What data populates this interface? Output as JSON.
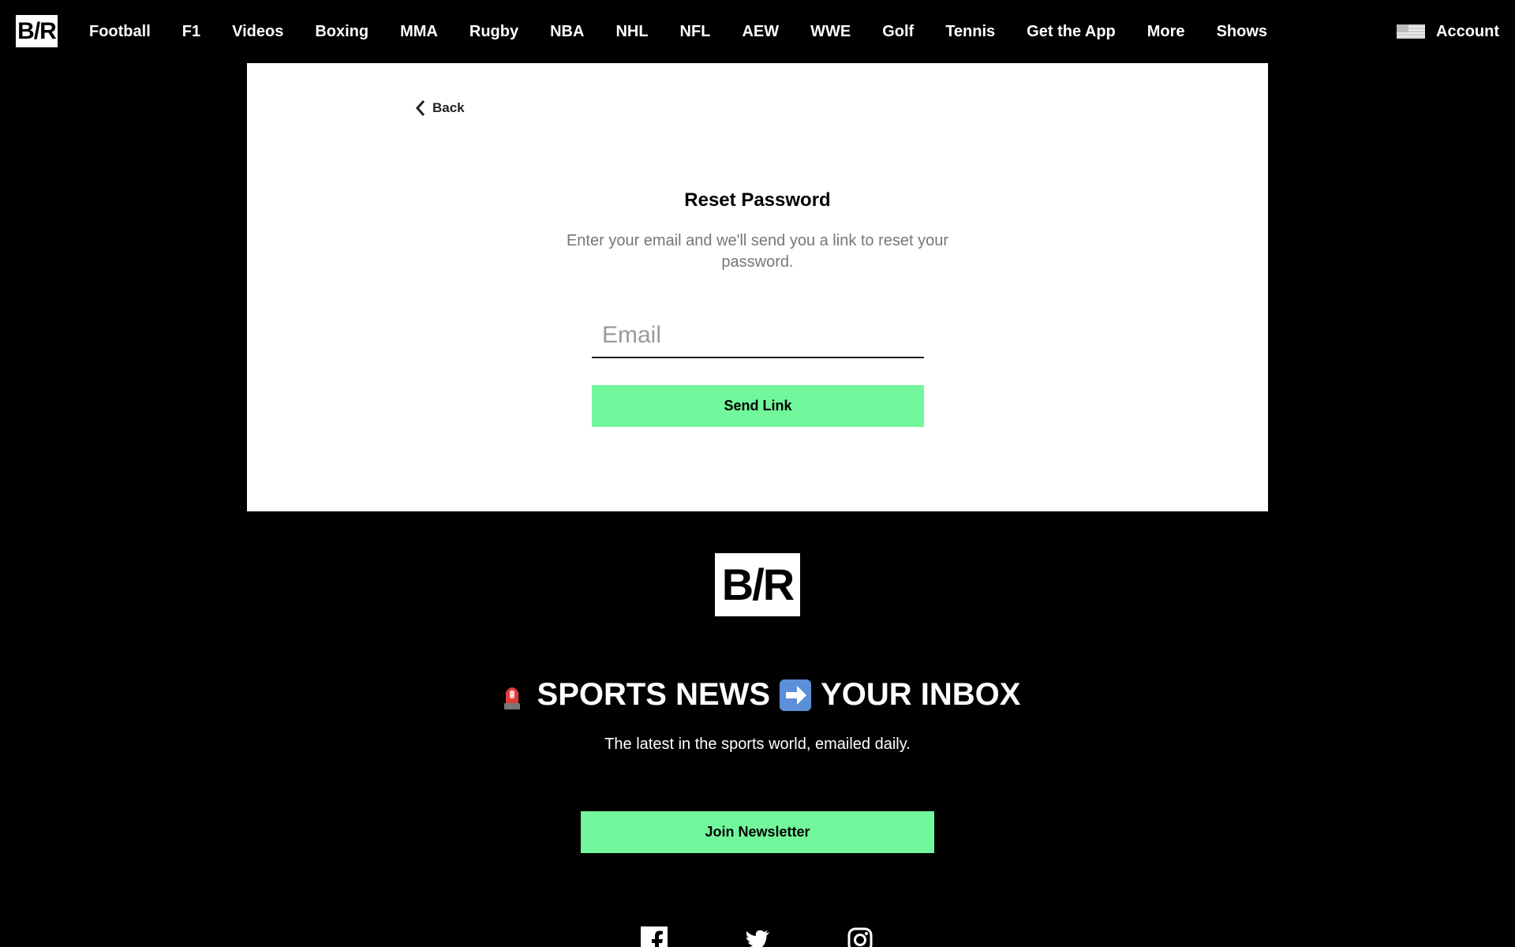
{
  "nav": {
    "logo_text": "B/R",
    "items": [
      "Football",
      "F1",
      "Videos",
      "Boxing",
      "MMA",
      "Rugby",
      "NBA",
      "NHL",
      "NFL",
      "AEW",
      "WWE",
      "Golf",
      "Tennis",
      "Get the App",
      "More",
      "Shows"
    ],
    "account_label": "Account",
    "flag_icon": "us-flag-icon"
  },
  "reset": {
    "back_label": "Back",
    "title": "Reset Password",
    "subtitle": "Enter your email and we'll send you a link to reset your password.",
    "email_placeholder": "Email",
    "email_value": "",
    "send_label": "Send Link"
  },
  "footer": {
    "logo_text": "B/R",
    "heading_part1": "SPORTS NEWS",
    "heading_part2": "YOUR INBOX",
    "heading_icon_1": "siren-emoji-icon",
    "heading_icon_2": "right-arrow-emoji-icon",
    "subheading": "The latest in the sports world, emailed daily.",
    "join_label": "Join Newsletter",
    "social_icons": [
      "facebook-icon",
      "twitter-icon",
      "instagram-icon"
    ]
  },
  "colors": {
    "accent_green": "#72f79c",
    "background": "#000000",
    "card": "#ffffff"
  }
}
